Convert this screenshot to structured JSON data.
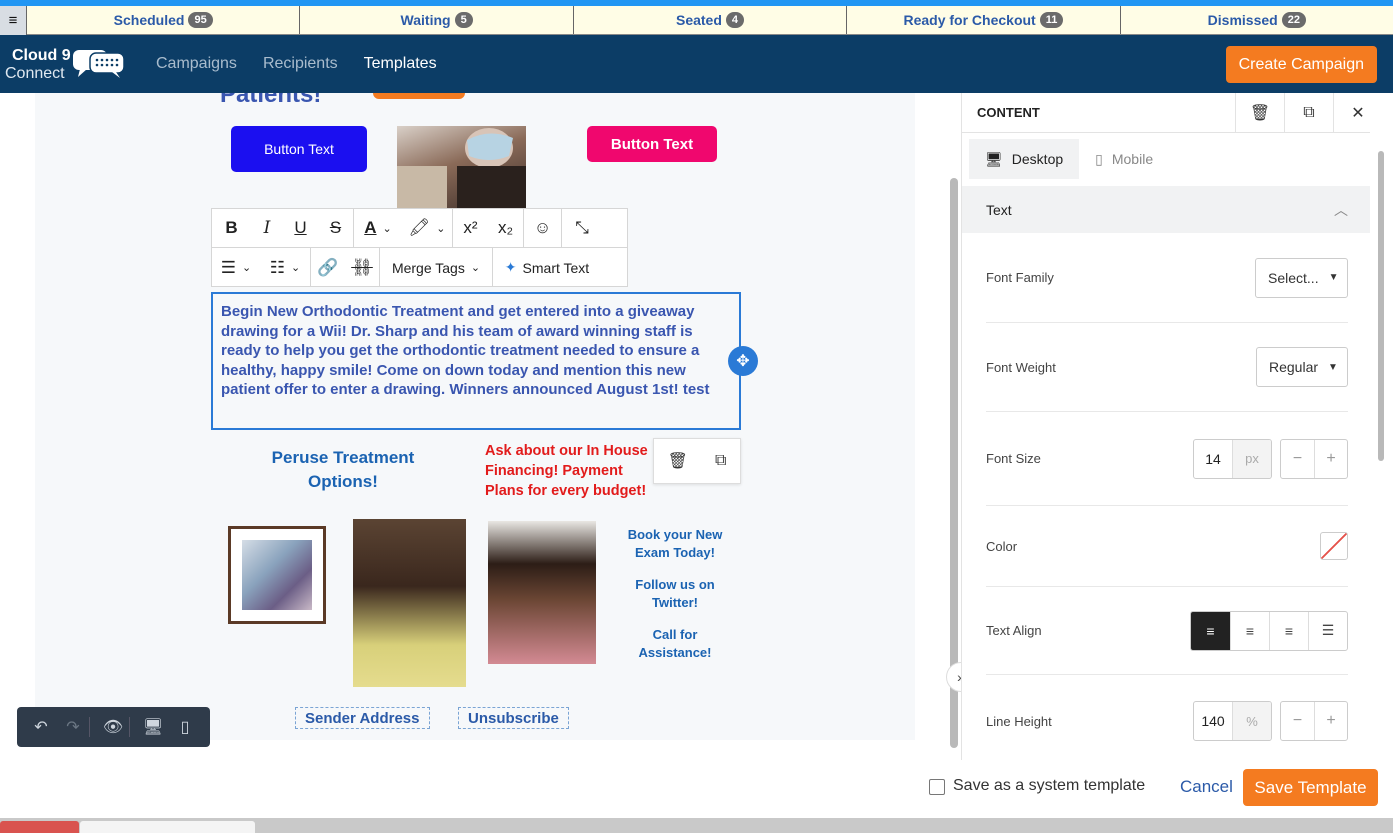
{
  "statusbar": {
    "menu_icon": "≡",
    "items": [
      {
        "label": "Scheduled",
        "count": "95"
      },
      {
        "label": "Waiting",
        "count": "5"
      },
      {
        "label": "Seated",
        "count": "4"
      },
      {
        "label": "Ready for Checkout",
        "count": "11"
      },
      {
        "label": "Dismissed",
        "count": "22"
      }
    ]
  },
  "nav": {
    "logo_line1": "Cloud 9",
    "logo_line2": "Connect",
    "links": [
      "Campaigns",
      "Recipients",
      "Templates"
    ],
    "active": "Templates",
    "create_button": "Create Campaign"
  },
  "email": {
    "heading": "Patients!",
    "button_blue": "Button Text",
    "button_pink": "Button Text",
    "toolbar": {
      "merge_tags": "Merge Tags",
      "smart_text": "Smart Text"
    },
    "body_text": "Begin New Orthodontic Treatment and get entered into a giveaway drawing for a Wii! Dr. Sharp and his team of award winning staff is ready to help you get the orthodontic treatment needed to ensure a healthy, happy smile! Come on down today and mention this new patient offer to enter a drawing. Winners announced August 1st! test",
    "peruse": "Peruse Treatment Options!",
    "ask": "Ask about our In House Financing! Payment Plans for every budget!",
    "side_links": [
      "Book your New Exam Today!",
      "Follow us on Twitter!",
      "Call for Assistance!"
    ],
    "footer_links": [
      "Sender Address",
      "Unsubscribe"
    ]
  },
  "panel": {
    "title": "CONTENT",
    "tabs": [
      "Desktop",
      "Mobile"
    ],
    "section": "Text",
    "font_family_label": "Font Family",
    "font_family_value": "Select...",
    "font_weight_label": "Font Weight",
    "font_weight_value": "Regular",
    "font_size_label": "Font Size",
    "font_size_value": "14",
    "font_size_unit": "px",
    "color_label": "Color",
    "text_align_label": "Text Align",
    "line_height_label": "Line Height",
    "line_height_value": "140",
    "line_height_unit": "%"
  },
  "footer": {
    "system_template_label": "Save as a system template",
    "cancel": "Cancel",
    "save": "Save Template"
  },
  "colors": {
    "accent": "#f47b20",
    "navbar": "#0c3d66",
    "link_blue": "#2b5aa8",
    "selection": "#2a7ad6"
  }
}
